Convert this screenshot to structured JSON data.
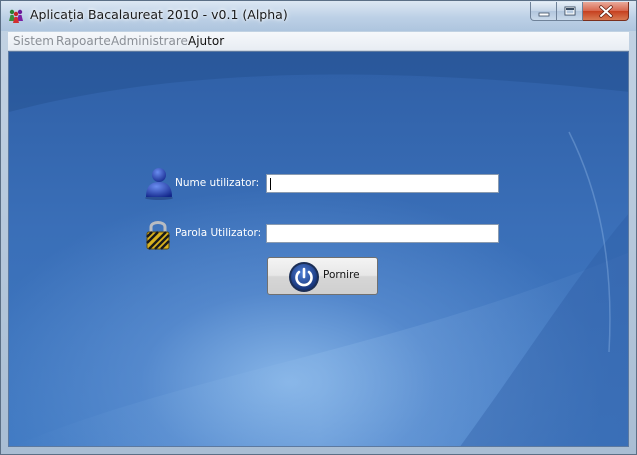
{
  "window": {
    "title": "Aplicația Bacalaureat 2010 - v0.1 (Alpha)"
  },
  "menu": [
    "Sistem",
    "Rapoarte",
    "Administrare",
    "Ajutor"
  ],
  "login": {
    "username_label": "Nume utilizator:",
    "username_value": "",
    "password_label": "Parola Utilizator:",
    "password_value": "",
    "submit_label": "Pornire"
  },
  "icons": {
    "app": "people-icon",
    "user": "user-icon",
    "lock": "lock-icon",
    "power": "power-icon",
    "minimize": "minimize-icon",
    "maximize": "maximize-icon",
    "close": "close-icon"
  },
  "colors": {
    "background": "#3a6fb8",
    "label_text": "#ffffff",
    "close_button": "#c6401f"
  }
}
